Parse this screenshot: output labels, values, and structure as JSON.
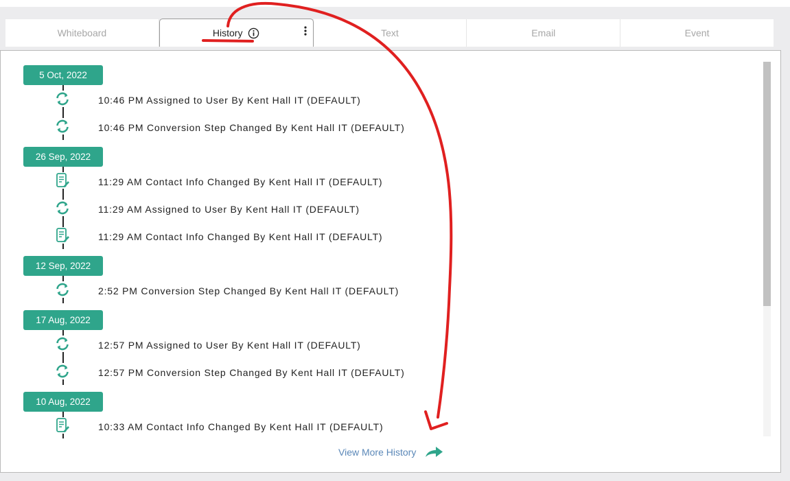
{
  "tabs": [
    {
      "label": "Whiteboard"
    },
    {
      "label": "History"
    },
    {
      "label": "Text"
    },
    {
      "label": "Email"
    },
    {
      "label": "Event"
    }
  ],
  "history": {
    "groups": [
      {
        "date": "5 Oct, 2022",
        "events": [
          {
            "icon": "sync-icon",
            "text": "10:46 PM Assigned to User By Kent Hall IT (DEFAULT)"
          },
          {
            "icon": "sync-icon",
            "text": "10:46 PM Conversion Step Changed By Kent Hall IT (DEFAULT)"
          }
        ]
      },
      {
        "date": "26 Sep, 2022",
        "events": [
          {
            "icon": "document-edit-icon",
            "text": "11:29 AM Contact Info Changed By Kent Hall IT (DEFAULT)"
          },
          {
            "icon": "sync-icon",
            "text": "11:29 AM Assigned to User By Kent Hall IT (DEFAULT)"
          },
          {
            "icon": "document-edit-icon",
            "text": "11:29 AM Contact Info Changed By Kent Hall IT (DEFAULT)"
          }
        ]
      },
      {
        "date": "12 Sep, 2022",
        "events": [
          {
            "icon": "sync-icon",
            "text": "2:52 PM Conversion Step Changed By Kent Hall IT (DEFAULT)"
          }
        ]
      },
      {
        "date": "17 Aug, 2022",
        "events": [
          {
            "icon": "sync-icon",
            "text": "12:57 PM Assigned to User By Kent Hall IT (DEFAULT)"
          },
          {
            "icon": "sync-icon",
            "text": "12:57 PM Conversion Step Changed By Kent Hall IT (DEFAULT)"
          }
        ]
      },
      {
        "date": "10 Aug, 2022",
        "events": [
          {
            "icon": "document-edit-icon",
            "text": "10:33 AM Contact Info Changed By Kent Hall IT (DEFAULT)"
          }
        ]
      }
    ],
    "view_more_label": "View More History"
  },
  "colors": {
    "accent": "#2fa58b",
    "link": "#5b88b8",
    "annotation": "#e02020"
  }
}
